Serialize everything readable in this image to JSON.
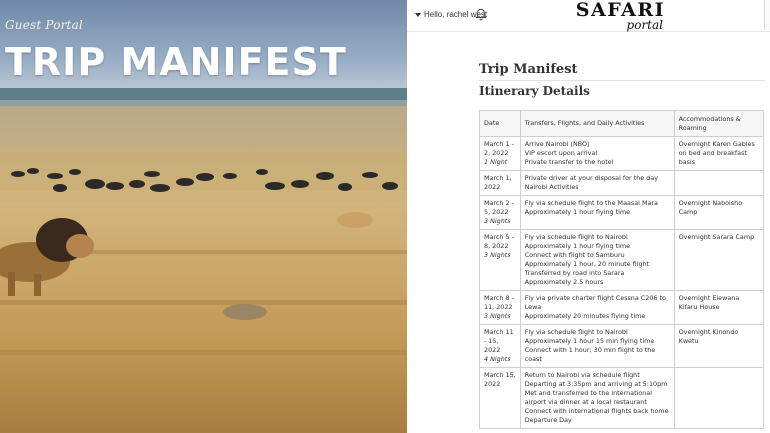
{
  "hero": {
    "portal_label": "Guest Portal",
    "title": "TRIP MANIFEST"
  },
  "header": {
    "greeting": "Hello, rachel west",
    "logo_main": "SAFARI",
    "logo_sub": "portal"
  },
  "icons": {
    "user_menu_caret": "caret-down-icon",
    "notifications": "bell-icon"
  },
  "main": {
    "page_title": "Trip Manifest",
    "section_title": "Itinerary Details",
    "table": {
      "columns": [
        "Date",
        "Transfers, Flights, and Daily Activities",
        "Accommodations & Roaming"
      ],
      "rows": [
        {
          "date": "March 1 - 2, 2022",
          "nights": "1 Night",
          "activities": [
            "Arrive Nairobi (NBO)",
            "VIP escort upon arrival",
            "Private transfer to the hotel"
          ],
          "accommodation": "Overnight Karen Gables on bed and breakfast basis"
        },
        {
          "date": "March 1, 2022",
          "nights": "",
          "activities": [
            "Private driver at your disposal for the day",
            "Nairobi Activities"
          ],
          "accommodation": ""
        },
        {
          "date": "March 2 - 5, 2022",
          "nights": "3 Nights",
          "activities": [
            "Fly via schedule flight to the Maasai Mara",
            "Approximately 1 hour flying time"
          ],
          "accommodation": "Overnight Naboisho Camp"
        },
        {
          "date": "March 5 - 8, 2022",
          "nights": "3 Nights",
          "activities": [
            "Fly via schedule flight to Nairobi",
            "Approximately 1 hour flying time",
            "Connect with flight to Samburu",
            "Approximately 1 hour, 20 minute flight",
            "Transferred by road into Sarara",
            "Approximately 2.5 hours"
          ],
          "accommodation": "Overnight Sarara Camp"
        },
        {
          "date": "March 8 - 11, 2022",
          "nights": "3 Nights",
          "activities": [
            "Fly via private charter flight Cessna C206 to Lewa",
            "Approximately 20 minutes flying time"
          ],
          "accommodation": "Overnight Elewana Kifaru House"
        },
        {
          "date": "March 11 - 15, 2022",
          "nights": "4 Nights",
          "activities": [
            "Fly via schedule flight to Nairobi",
            "Approximately 1 hour 15 min flying time",
            "Connect with 1 hour; 30 min flight to the coast"
          ],
          "accommodation": "Overnight Kinondo Kwetu"
        },
        {
          "date": "March 15, 2022",
          "nights": "",
          "activities": [
            "Return to Nairobi via schedule flight",
            "Departing at 3:35pm and arriving at 5:10pm",
            "Met and transferred to the international airport via dinner at a local restaurant",
            "Connect with international flights back home",
            "Departure Day"
          ],
          "accommodation": ""
        }
      ]
    }
  }
}
